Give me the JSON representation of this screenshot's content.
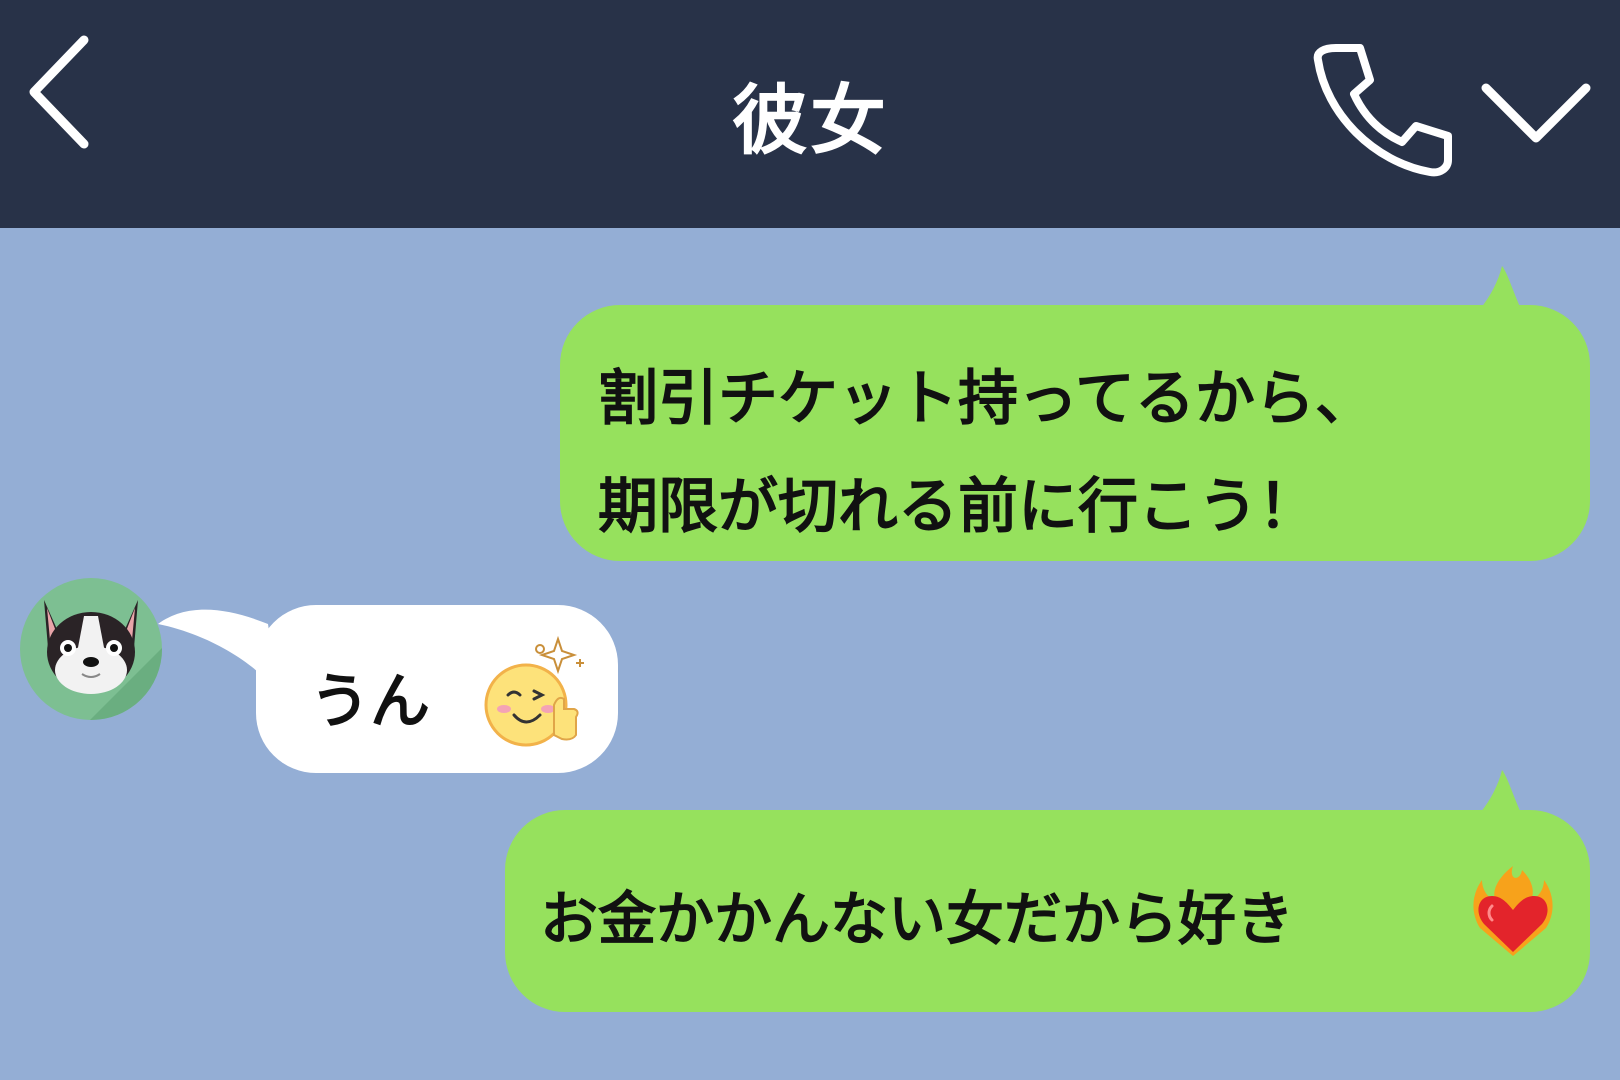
{
  "header": {
    "title": "彼女",
    "back_icon": "chevron-left-icon",
    "call_icon": "phone-icon",
    "menu_icon": "chevron-down-icon"
  },
  "colors": {
    "header_bg": "#283248",
    "chat_bg": "#94aed5",
    "outgoing_bubble": "#96e15d",
    "incoming_bubble": "#ffffff"
  },
  "messages": [
    {
      "direction": "outgoing",
      "lines": [
        "割引チケット持ってるから、",
        "期限が切れる前に行こう！"
      ]
    },
    {
      "direction": "incoming",
      "text": "うん",
      "sticker": "wink-thumbsup-emoji",
      "avatar": "dog-avatar"
    },
    {
      "direction": "outgoing",
      "text": "お金かかんない女だから好き",
      "emoji": "heart-on-fire-emoji"
    }
  ]
}
